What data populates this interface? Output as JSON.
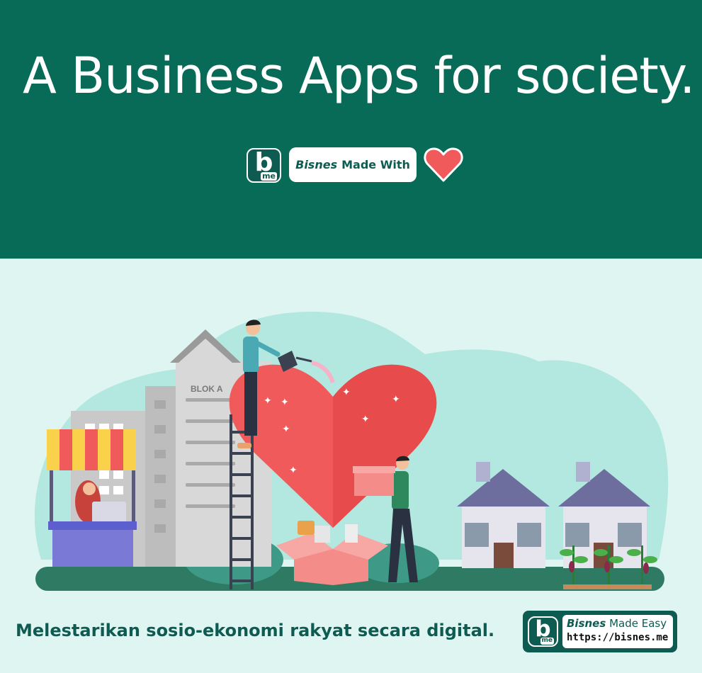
{
  "hero": {
    "headline": "A Business Apps for society.",
    "logo_letter": "b",
    "logo_sub": "me",
    "pill_brand": "Bisnes",
    "pill_text": "Made With",
    "heart_icon": "heart-icon"
  },
  "illustration": {
    "building_label": "BLOK A"
  },
  "footer": {
    "tagline": "Melestarikan sosio-ekonomi rakyat secara digital.",
    "logo_letter": "b",
    "logo_sub": "me",
    "badge_brand": "Bisnes",
    "badge_text": "Made Easy",
    "badge_url": "https://bisnes.me"
  },
  "colors": {
    "primary": "#076b57",
    "dark_teal": "#0e5b52",
    "light_bg": "#dff5f1",
    "heart": "#f05a5a"
  }
}
